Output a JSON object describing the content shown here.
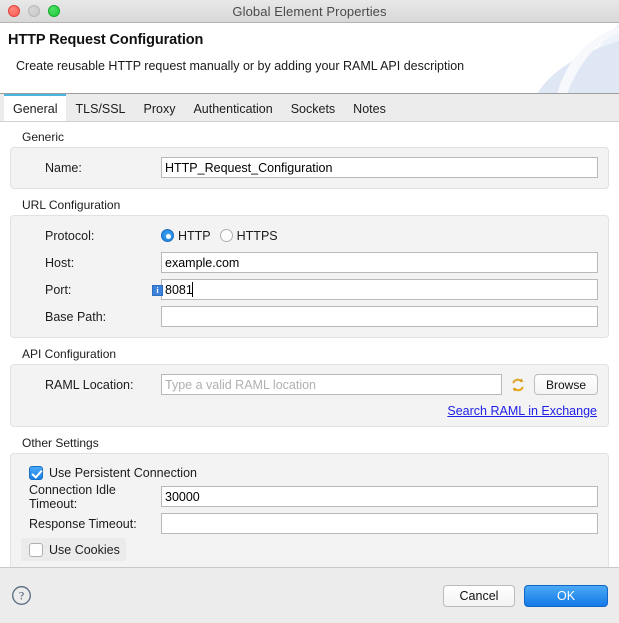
{
  "window": {
    "title": "Global Element Properties",
    "traffic_lights": [
      "close-button",
      "minimize-button",
      "maximize-button"
    ]
  },
  "banner": {
    "heading": "HTTP Request Configuration",
    "subtitle": "Create reusable HTTP request manually or by adding your RAML API description"
  },
  "tabs": [
    {
      "label": "General",
      "active": true
    },
    {
      "label": "TLS/SSL",
      "active": false
    },
    {
      "label": "Proxy",
      "active": false
    },
    {
      "label": "Authentication",
      "active": false
    },
    {
      "label": "Sockets",
      "active": false
    },
    {
      "label": "Notes",
      "active": false
    }
  ],
  "sections": {
    "generic": {
      "label": "Generic",
      "name_label": "Name:",
      "name_value": "HTTP_Request_Configuration",
      "name_placeholder": ""
    },
    "url_configuration": {
      "label": "URL Configuration",
      "protocol_label": "Protocol:",
      "protocol_options": [
        {
          "label": "HTTP",
          "selected": true
        },
        {
          "label": "HTTPS",
          "selected": false
        }
      ],
      "host_label": "Host:",
      "host_value": "example.com",
      "port_label": "Port:",
      "port_value": "8081",
      "port_info_badge": "i",
      "base_path_label": "Base Path:",
      "base_path_value": ""
    },
    "api_configuration": {
      "label": "API Configuration",
      "raml_location_label": "RAML Location:",
      "raml_location_value": "",
      "raml_location_placeholder": "Type a valid RAML location",
      "refresh_icon": "sync-arrows-icon",
      "browse_label": "Browse",
      "exchange_link": "Search RAML in Exchange"
    },
    "other_settings": {
      "label": "Other Settings",
      "persistent_connection_label": "Use Persistent Connection",
      "persistent_connection_checked": true,
      "idle_timeout_label": "Connection Idle Timeout:",
      "idle_timeout_value": "30000",
      "response_timeout_label": "Response Timeout:",
      "response_timeout_value": "",
      "use_cookies_label": "Use Cookies",
      "use_cookies_checked": false
    }
  },
  "footer": {
    "help_icon": "help-question-icon",
    "cancel_label": "Cancel",
    "ok_label": "OK"
  },
  "colors": {
    "accent_blue": "#1479e8",
    "tab_active_underline": "#4ab6e0",
    "link_blue": "#2020e8",
    "info_badge": "#3b82dd",
    "sync_icon_gold": "#e8a81c"
  }
}
